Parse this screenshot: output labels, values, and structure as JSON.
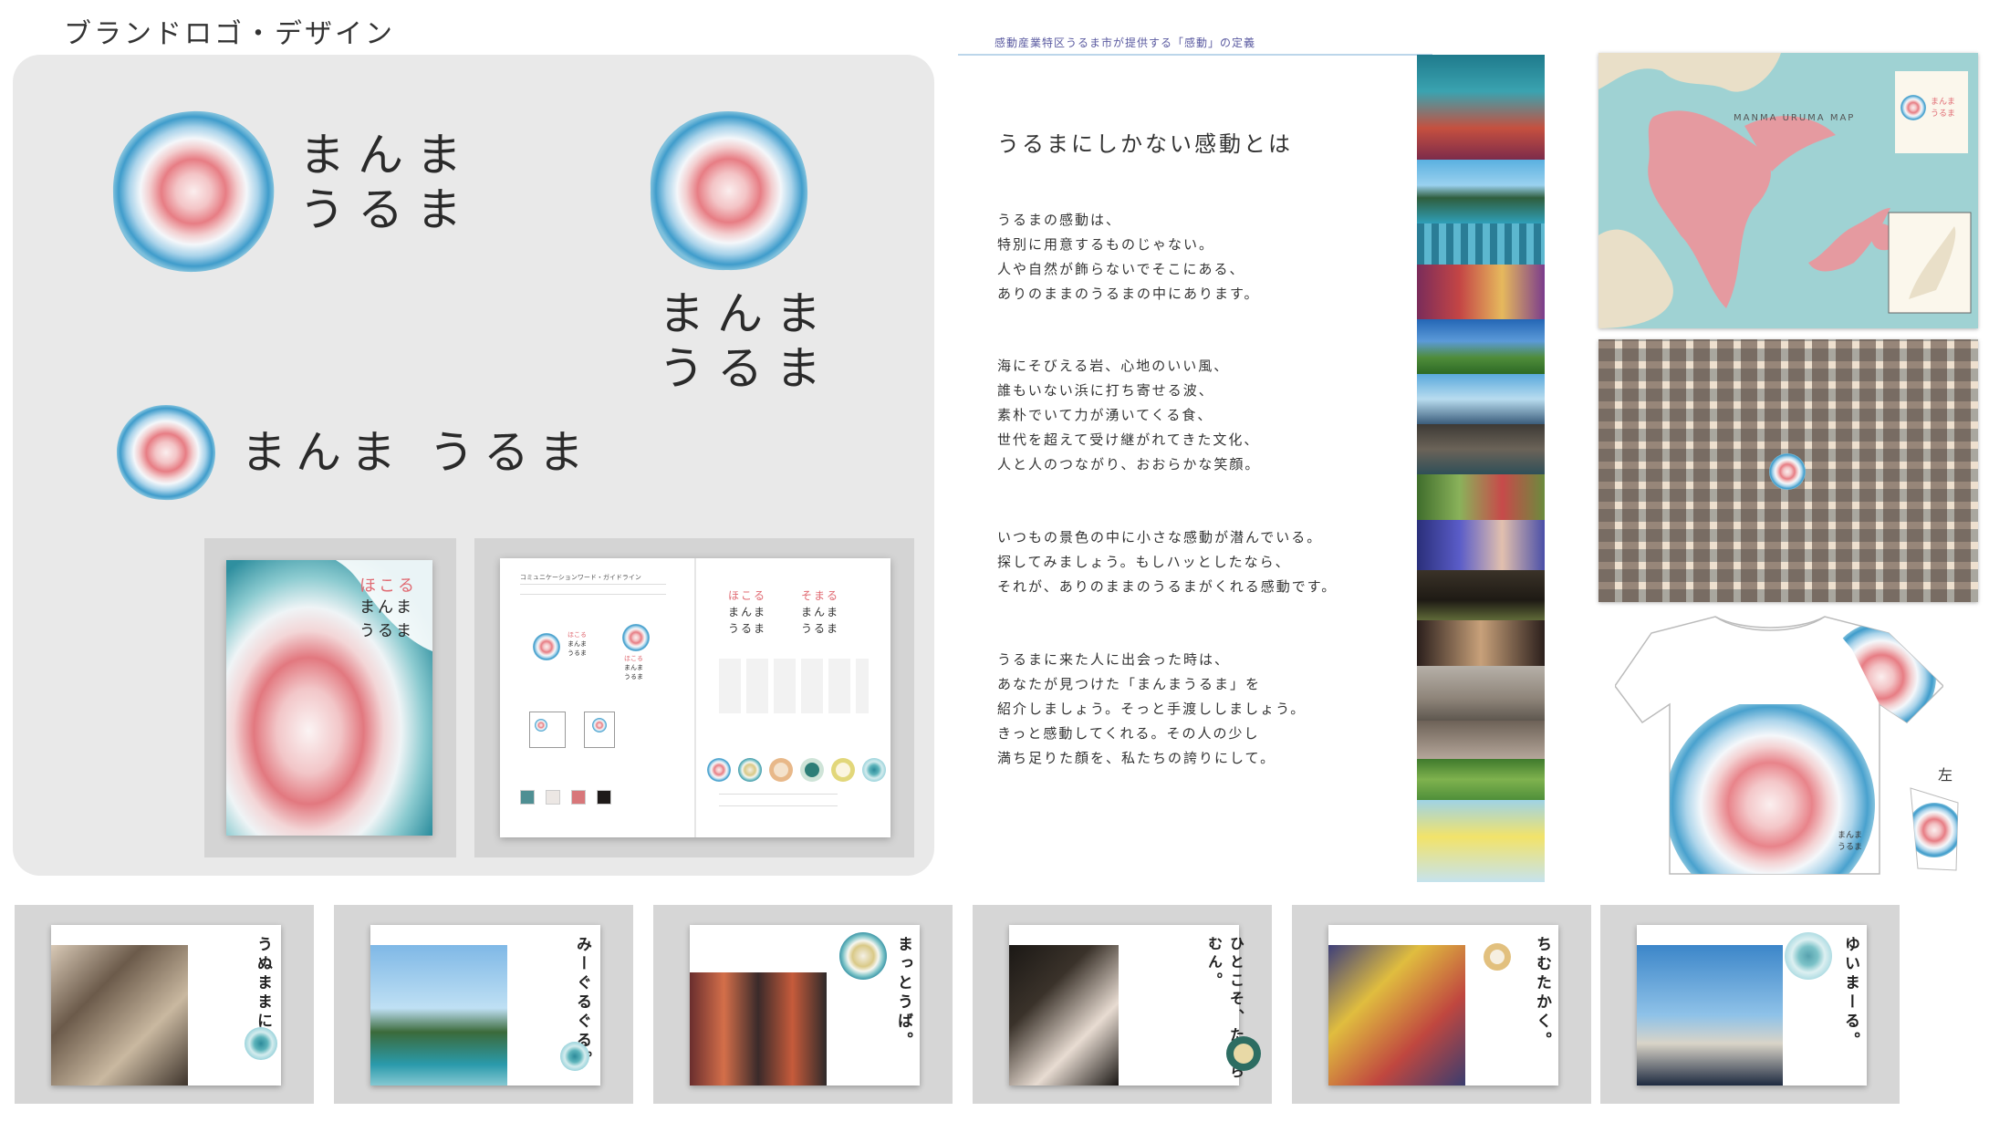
{
  "heading": "ブランドロゴ・デザイン",
  "logos": {
    "line1": "まんま",
    "line2": "うるま",
    "horizontal": "まんま うるま"
  },
  "cover": {
    "word": "ほこる",
    "line1": "まんま",
    "line2": "うるま"
  },
  "guide": {
    "title": "コミュニケーションワード・ガイドライン",
    "word_left": "ほこる",
    "word_right": "そまる",
    "line1": "まんま",
    "line2": "うるま",
    "swatch_colors": [
      "#4f8f93",
      "#ece7e4",
      "#d8777a",
      "#1e1a19"
    ]
  },
  "concept": {
    "caption": "感動産業特区うるま市が提供する「感動」の定義",
    "title": "うるまにしかない感動とは",
    "paragraphs": [
      [
        "うるまの感動は、",
        "特別に用意するものじゃない。",
        "人や自然が飾らないでそこにある、",
        "ありのままのうるまの中にあります。"
      ],
      [
        "海にそびえる岩、心地のいい風、",
        "誰もいない浜に打ち寄せる波、",
        "素朴でいて力が湧いてくる食、",
        "世代を超えて受け継がれてきた文化、",
        "人と人のつながり、おおらかな笑顔。"
      ],
      [
        "いつもの景色の中に小さな感動が潜んでいる。",
        "探してみましょう。もしハッとしたなら、",
        "それが、ありのままのうるまがくれる感動です。"
      ],
      [
        "うるまに来た人に出会った時は、",
        "あなたが見つけた「まんまうるま」を",
        "紹介しましょう。そっと手渡ししましょう。",
        "きっと感動してくれる。その人の少し",
        "満ち足りた顔を、私たちの誇りにして。"
      ]
    ]
  },
  "map": {
    "title": "MANMA URUMA MAP",
    "logo_line1": "まんま",
    "logo_line2": "うるま"
  },
  "tshirt": {
    "label_line1": "まんま",
    "label_line2": "うるま",
    "side_label": "左"
  },
  "spreads": [
    {
      "title": "うぬままに。"
    },
    {
      "title": "みーぐるぐる。"
    },
    {
      "title": "まっとうば。"
    },
    {
      "title": "ひとこそ、たからむん。"
    },
    {
      "title": "ちむたかく。"
    },
    {
      "title": "ゆいまーる。"
    }
  ]
}
